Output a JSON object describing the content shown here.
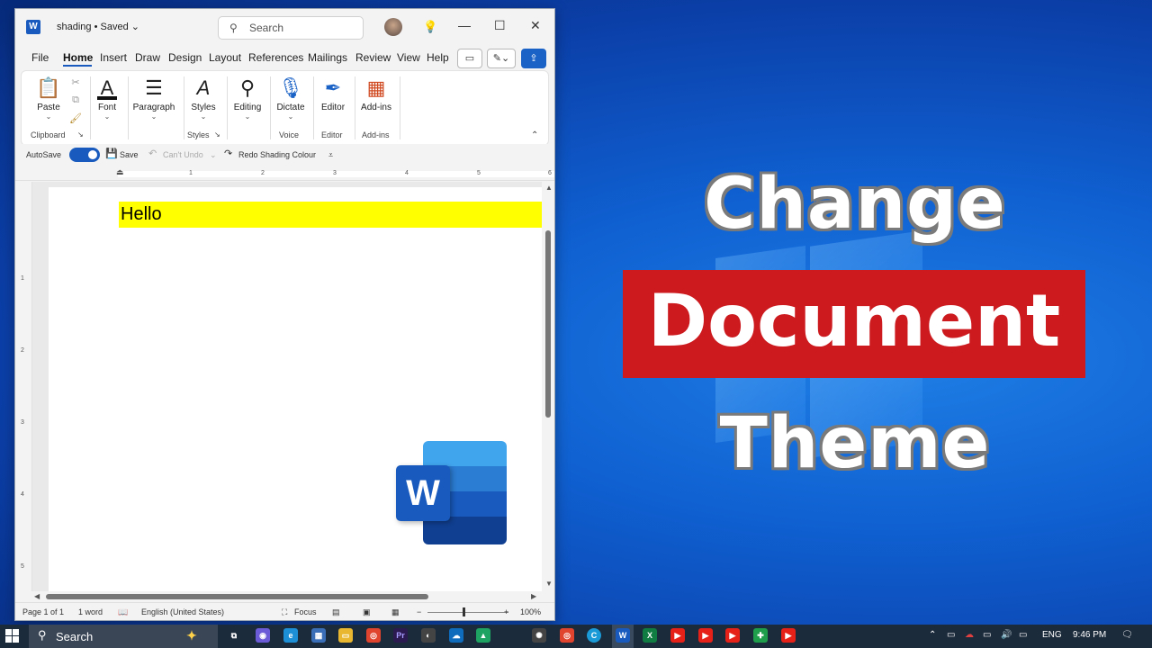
{
  "word": {
    "doc_title": "shading • Saved",
    "search_placeholder": "Search",
    "tabs": [
      "File",
      "Home",
      "Insert",
      "Draw",
      "Design",
      "Layout",
      "References",
      "Mailings",
      "Review",
      "View",
      "Help"
    ],
    "active_tab": "Home",
    "ribbon": {
      "paste": "Paste",
      "clipboard_label": "Clipboard",
      "font": "Font",
      "paragraph": "Paragraph",
      "styles": "Styles",
      "styles_label": "Styles",
      "editing": "Editing",
      "dictate": "Dictate",
      "voice_label": "Voice",
      "editor": "Editor",
      "editor_label": "Editor",
      "addins": "Add-ins",
      "addins_label": "Add-ins"
    },
    "qat": {
      "autosave": "AutoSave",
      "save": "Save",
      "undo": "Can't Undo",
      "redo": "Redo Shading Colour"
    },
    "ruler_numbers": [
      "1",
      "2",
      "3",
      "4",
      "5",
      "6"
    ],
    "vruler_numbers": [
      "1",
      "2",
      "3",
      "4",
      "5"
    ],
    "document_text": "Hello",
    "highlight_color": "#ffff00",
    "status": {
      "page": "Page 1 of 1",
      "words": "1 word",
      "language": "English (United States)",
      "focus": "Focus",
      "zoom": "100%"
    }
  },
  "overlay": {
    "line1": "Change",
    "line2": "Document",
    "line3": "Theme",
    "accent_red": "#cc1a1f"
  },
  "taskbar": {
    "search": "Search",
    "lang": "ENG",
    "time": "9:46 PM"
  }
}
